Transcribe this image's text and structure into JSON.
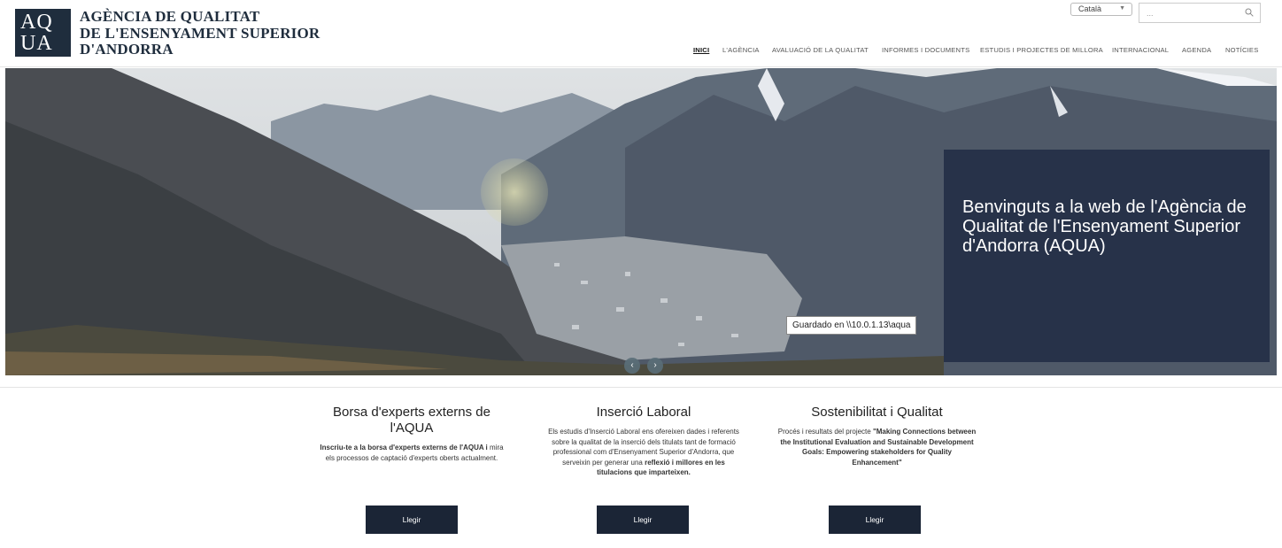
{
  "logo": {
    "mark_line1": "AQ",
    "mark_line2": "UA",
    "text_lines": [
      "AGÈNCIA DE QUALITAT",
      "DE L'ENSENYAMENT SUPERIOR",
      "D'ANDORRA"
    ]
  },
  "language_select": {
    "selected": "Català"
  },
  "search": {
    "placeholder": "..."
  },
  "nav": {
    "items": [
      {
        "label": "INICI",
        "active": true
      },
      {
        "label": "L'AGÈNCIA"
      },
      {
        "label": "AVALUACIÓ DE LA QUALITAT"
      },
      {
        "label": "INFORMES I DOCUMENTS"
      },
      {
        "label": "ESTUDIS I PROJECTES DE MILLORA"
      },
      {
        "label": "INTERNACIONAL"
      },
      {
        "label": "AGENDA"
      },
      {
        "label": "NOTÍCIES"
      }
    ]
  },
  "hero": {
    "caption": "Benvinguts a la web de l'Agència de Qualitat de l'Ensenyament Superior d'Andorra (AQUA)",
    "tooltip": "Guardado en \\\\10.0.1.13\\aqua",
    "prev_icon": "chevron-left-icon",
    "next_icon": "chevron-right-icon"
  },
  "cards": [
    {
      "title": "Borsa d'experts externs de l'AQUA",
      "body_bold": "Inscriu-te a la borsa d'experts externs de l'AQUA i",
      "body_plain": "mira els processos de captació d'experts oberts actualment.",
      "button": "Llegir"
    },
    {
      "title": "Inserció Laboral",
      "body_plain": "Els estudis d'Inserció Laboral ens ofereixen dades i referents sobre la qualitat de la inserció dels titulats tant de formació professional com d'Ensenyament Superior d'Andorra, que serveixin per generar una",
      "body_bold": "reflexió i millores en les titulacions que imparteixen.",
      "button": "Llegir"
    },
    {
      "title": "Sostenibilitat i Qualitat",
      "body_plain": "Procés i resultats del projecte",
      "body_bold": "\"Making Connections between the Institutional Evaluation and Sustainable Development Goals: Empowering stakeholders for Quality Enhancement\"",
      "button": "Llegir"
    }
  ],
  "colors": {
    "brand_navy": "#1f2d3d",
    "button_navy": "#1b2536",
    "caption_bg": "#1e2a42"
  }
}
